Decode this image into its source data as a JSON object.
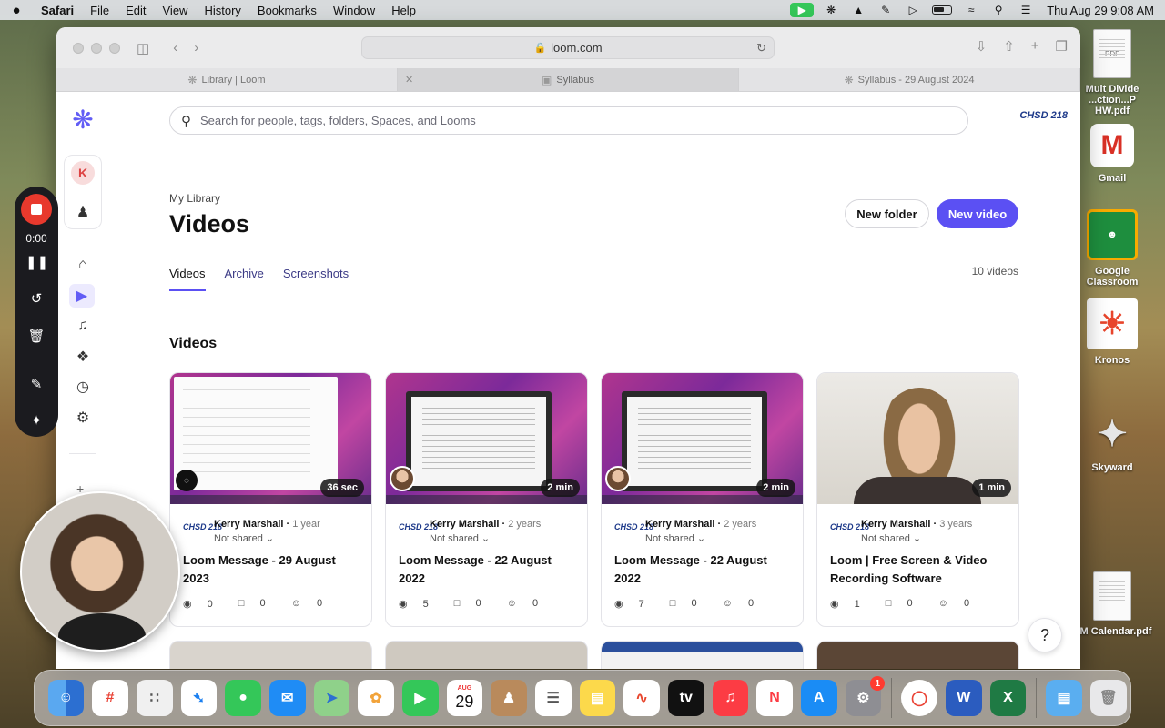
{
  "menubar": {
    "apple": "",
    "app": "Safari",
    "items": [
      "File",
      "Edit",
      "View",
      "History",
      "Bookmarks",
      "Window",
      "Help"
    ],
    "clock": "Thu Aug 29  9:08 AM"
  },
  "desktop": {
    "icons": [
      {
        "label": "Mult Divide ...ction...P HW.pdf",
        "icon": "pdf-file-icon"
      },
      {
        "label": "Gmail",
        "icon": "gmail-icon"
      },
      {
        "label": "Google Classroom",
        "icon": "classroom-icon"
      },
      {
        "label": "Kronos",
        "icon": "kronos-icon"
      },
      {
        "label": "Skyward",
        "icon": "skyward-icon"
      },
      {
        "label": "CM Calendar.pdf",
        "icon": "pdf-file-icon"
      }
    ]
  },
  "browser": {
    "url": "loom.com",
    "tabs": [
      {
        "label": "Library | Loom",
        "active": false
      },
      {
        "label": "Syllabus",
        "active": true
      },
      {
        "label": "Syllabus - 29 August 2024",
        "active": false
      }
    ]
  },
  "loom": {
    "search_placeholder": "Search for people, tags, folders, Spaces, and Looms",
    "org_logo": "CHSD 218",
    "avatar_initial": "K",
    "eyebrow": "My Library",
    "title": "Videos",
    "new_folder": "New folder",
    "new_video": "New video",
    "tabs": [
      "Videos",
      "Archive",
      "Screenshots"
    ],
    "video_count": "10 videos",
    "section_title": "Videos",
    "cards": [
      {
        "duration": "36 sec",
        "author": "Kerry Marshall",
        "age": "1 year",
        "share": "Not shared",
        "title": "Loom Message - 29 August 2023",
        "views": "0",
        "comments": "0",
        "reactions": "0",
        "thumb": "lms"
      },
      {
        "duration": "2 min",
        "author": "Kerry Marshall",
        "age": "2 years",
        "share": "Not shared",
        "title": "Loom Message - 22 August 2022",
        "views": "5",
        "comments": "0",
        "reactions": "0",
        "thumb": "paper"
      },
      {
        "duration": "2 min",
        "author": "Kerry Marshall",
        "age": "2 years",
        "share": "Not shared",
        "title": "Loom Message - 22 August 2022",
        "views": "7",
        "comments": "0",
        "reactions": "0",
        "thumb": "paper"
      },
      {
        "duration": "1 min",
        "author": "Kerry Marshall",
        "age": "3 years",
        "share": "Not shared",
        "title": "Loom | Free Screen & Video Recording Software",
        "views": "1",
        "comments": "0",
        "reactions": "0",
        "thumb": "face"
      }
    ],
    "help": "?"
  },
  "recorder": {
    "time": "0:00"
  },
  "dock": {
    "calendar_month": "AUG",
    "calendar_day": "29",
    "settings_badge": "1"
  },
  "colors": {
    "accent": "#5b50f3",
    "record": "#e8392d"
  }
}
